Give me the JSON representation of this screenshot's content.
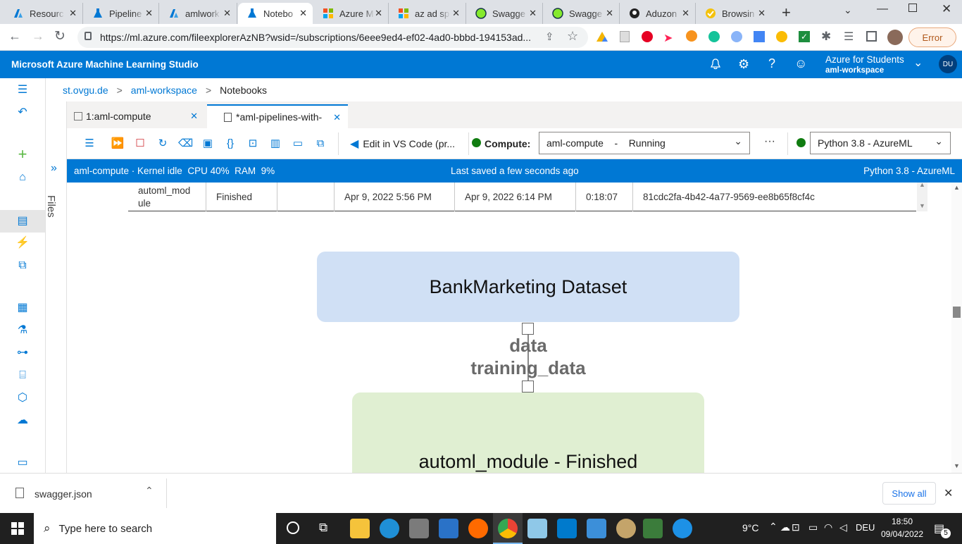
{
  "browser": {
    "tabs": [
      {
        "title": "Resourc",
        "icon": "azure-icon"
      },
      {
        "title": "Pipeline",
        "icon": "aml-flask-icon"
      },
      {
        "title": "amlwork",
        "icon": "azure-icon"
      },
      {
        "title": "Notebo",
        "icon": "aml-flask-icon"
      },
      {
        "title": "Azure M",
        "icon": "microsoft-icon"
      },
      {
        "title": "az ad sp",
        "icon": "microsoft-icon"
      },
      {
        "title": "Swagge",
        "icon": "swagger-icon"
      },
      {
        "title": "Swagge",
        "icon": "swagger-icon"
      },
      {
        "title": "Aduzon",
        "icon": "github-icon"
      },
      {
        "title": "Browsin",
        "icon": "check-icon"
      }
    ],
    "new_tab": "+",
    "url": "https://ml.azure.com/fileexplorerAzNB?wsid=/subscriptions/6eee9ed4-ef02-4ad0-bbbd-194153ad...",
    "error_label": "Error"
  },
  "app": {
    "title": "Microsoft Azure Machine Learning Studio",
    "account_line1": "Azure for Students",
    "account_line2": "aml-workspace",
    "avatar_initials": "DU"
  },
  "breadcrumb": {
    "items": [
      "st.ovgu.de",
      "aml-workspace",
      "Notebooks"
    ],
    "sep": ">"
  },
  "files_label": "Files",
  "notebook_tabs": [
    {
      "label": "1:aml-compute"
    },
    {
      "label": "*aml-pipelines-with-"
    }
  ],
  "toolbar": {
    "vscode_label": "Edit in VS Code (pr...",
    "compute_label": "Compute:",
    "compute_value": "aml-compute    -    Running",
    "more": "···",
    "kernel_value": "Python 3.8 - AzureML"
  },
  "status": {
    "left": "aml-compute · Kernel idle  CPU 40%  RAM  9%",
    "center": "Last saved a few seconds ago",
    "right": "Python 3.8 - AzureML"
  },
  "table_row": {
    "cells": [
      "automl_mod\nule",
      "Finished",
      "",
      "Apr 9, 2022 5:56 PM",
      "Apr 9, 2022 6:14 PM",
      "0:18:07",
      "81cdc2fa-4b42-4a77-9569-ee8b65f8cf4c"
    ]
  },
  "graph": {
    "dataset_node": "BankMarketing Dataset",
    "edge_label1": "data",
    "edge_label2": "training_data",
    "module_node": "automl_module - Finished",
    "dataset_color": "#d0e0f5",
    "module_color": "#e0efd2"
  },
  "download": {
    "file": "swagger.json",
    "show_all": "Show all"
  },
  "taskbar": {
    "search_placeholder": "Type here to search",
    "temperature": "9°C",
    "language": "DEU",
    "time": "18:50",
    "date": "09/04/2022",
    "notif_count": "5"
  }
}
